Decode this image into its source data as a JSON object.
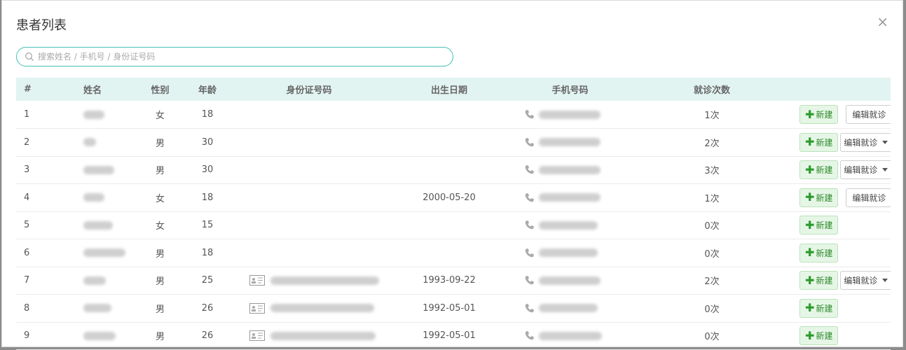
{
  "modal": {
    "title": "患者列表",
    "close_symbol": "×"
  },
  "search": {
    "placeholder": "搜索姓名 / 手机号 / 身份证号码",
    "value": ""
  },
  "table": {
    "headers": [
      "#",
      "姓名",
      "性别",
      "年龄",
      "身份证号码",
      "出生日期",
      "手机号码",
      "就诊次数",
      ""
    ],
    "new_button_label": "新建",
    "edit_button_label": "编辑就诊",
    "rows": [
      {
        "index": "1",
        "gender": "女",
        "age": "18",
        "birth": "",
        "phone_visible": "…",
        "visits": "1次",
        "has_id": false,
        "edit": "button"
      },
      {
        "index": "2",
        "gender": "男",
        "age": "30",
        "birth": "",
        "phone_visible": "…",
        "visits": "2次",
        "has_id": false,
        "edit": "dropdown"
      },
      {
        "index": "3",
        "gender": "男",
        "age": "30",
        "birth": "",
        "phone_visible": "…",
        "visits": "3次",
        "has_id": false,
        "edit": "dropdown"
      },
      {
        "index": "4",
        "gender": "女",
        "age": "18",
        "birth": "2000-05-20",
        "phone_visible": "…",
        "visits": "1次",
        "has_id": false,
        "edit": "button"
      },
      {
        "index": "5",
        "gender": "女",
        "age": "15",
        "birth": "",
        "phone_visible": "…",
        "visits": "0次",
        "has_id": false,
        "edit": "none"
      },
      {
        "index": "6",
        "gender": "男",
        "age": "18",
        "birth": "",
        "phone_visible": "…",
        "visits": "0次",
        "has_id": false,
        "edit": "none"
      },
      {
        "index": "7",
        "gender": "男",
        "age": "25",
        "birth": "1993-09-22",
        "phone_visible": "…",
        "visits": "2次",
        "has_id": true,
        "edit": "dropdown"
      },
      {
        "index": "8",
        "gender": "男",
        "age": "26",
        "birth": "1992-05-01",
        "phone_visible": "…",
        "visits": "0次",
        "has_id": true,
        "edit": "none"
      },
      {
        "index": "9",
        "gender": "男",
        "age": "26",
        "birth": "1992-05-01",
        "phone_visible": "…",
        "visits": "0次",
        "has_id": true,
        "edit": "none"
      }
    ]
  },
  "colors": {
    "accent": "#45c1b4",
    "header_bg": "#e2f4f1",
    "new_btn_bg": "#e6f6e6",
    "new_btn_text": "#2c8a2c"
  },
  "icons": {
    "search": "search-icon",
    "close": "close-icon",
    "phone": "phone-icon",
    "id_card": "id-card-icon",
    "plus": "plus-icon",
    "caret": "caret-down-icon"
  }
}
